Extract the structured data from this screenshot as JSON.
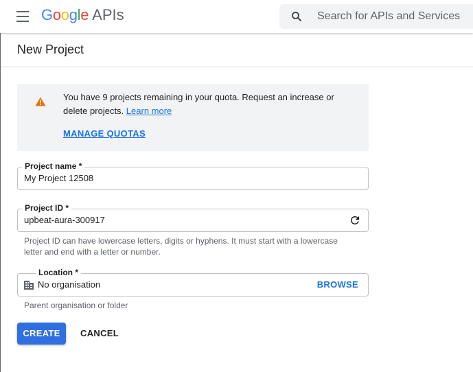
{
  "header": {
    "logo": {
      "google_letters": [
        {
          "char": "G",
          "color": "#4285F4"
        },
        {
          "char": "o",
          "color": "#EA4335"
        },
        {
          "char": "o",
          "color": "#FBBC05"
        },
        {
          "char": "g",
          "color": "#4285F4"
        },
        {
          "char": "l",
          "color": "#34A853"
        },
        {
          "char": "e",
          "color": "#EA4335"
        }
      ],
      "apis_text": "APIs"
    },
    "menu_icon": "hamburger-menu-icon",
    "search": {
      "icon": "search-icon",
      "placeholder": "Search for APIs and Services"
    }
  },
  "page": {
    "title": "New Project"
  },
  "notice": {
    "icon": "warning-icon",
    "text": "You have 9 projects remaining in your quota. Request an increase or delete projects.",
    "link_text": "Learn more",
    "action_label": "MANAGE QUOTAS"
  },
  "form": {
    "project_name": {
      "label": "Project name *",
      "value": "My Project 12508"
    },
    "project_id": {
      "label": "Project ID *",
      "value": "upbeat-aura-300917",
      "refresh_icon": "refresh-icon",
      "helper": "Project ID can have lowercase letters, digits or hyphens. It must start with a lowercase letter and end with a letter or number."
    },
    "location": {
      "label": "Location *",
      "value": "No organisation",
      "icon": "building-icon",
      "browse_label": "BROWSE",
      "helper": "Parent organisation or folder"
    }
  },
  "actions": {
    "create_label": "CREATE",
    "cancel_label": "CANCEL"
  },
  "colors": {
    "accent": "#1a73e8",
    "create_button": "#2f6fe0",
    "warning": "#e8710a",
    "notice_background": "#f1f3f4"
  }
}
